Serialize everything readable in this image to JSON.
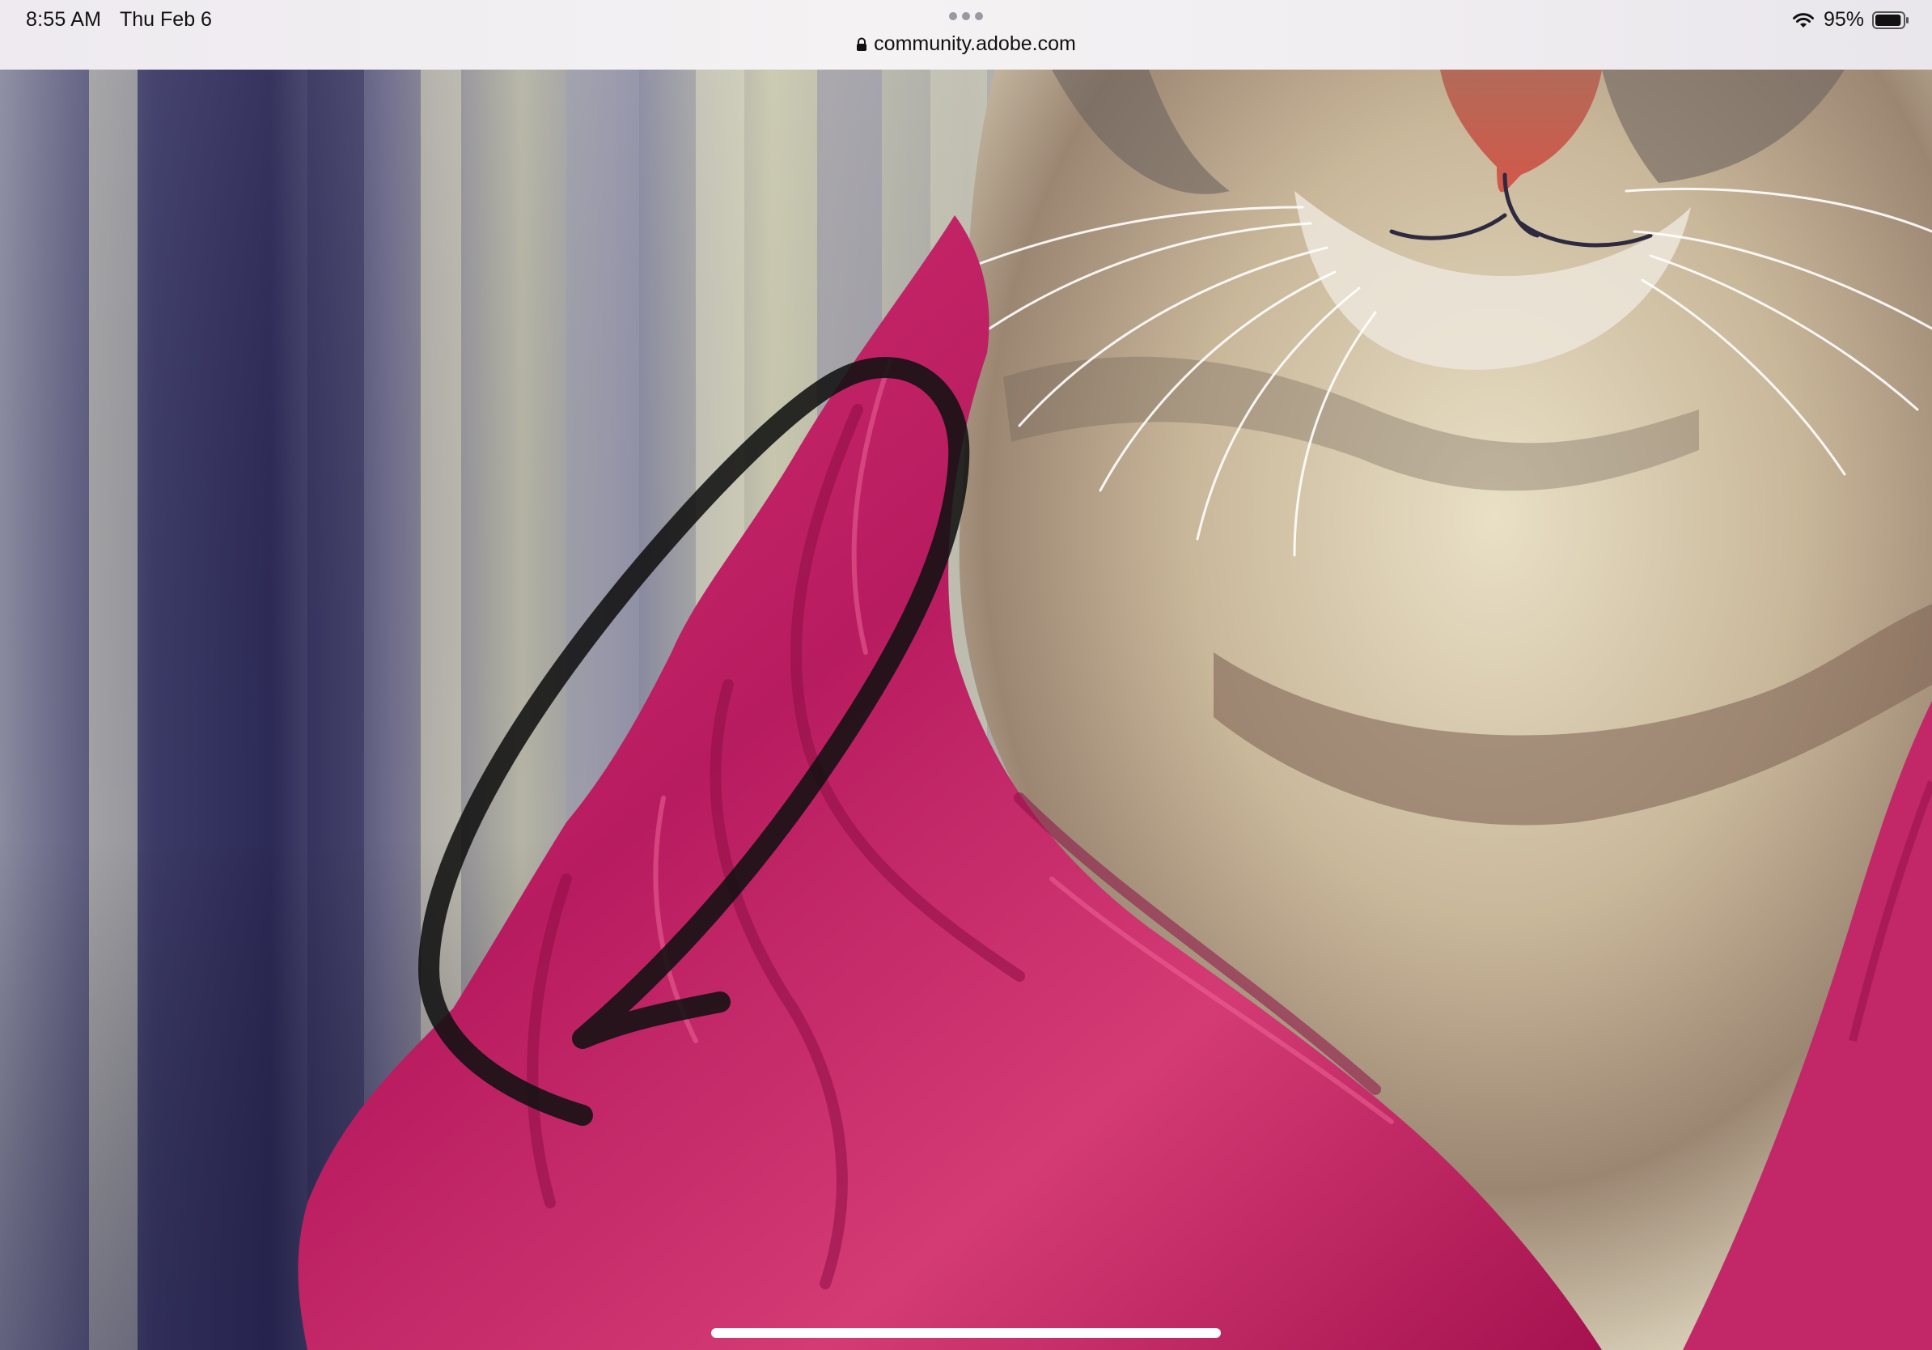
{
  "status_bar": {
    "time": "8:55 AM",
    "date": "Thu Feb 6",
    "battery_percent": "95%",
    "battery_level": 0.95,
    "wifi_icon": "wifi-icon",
    "battery_icon": "battery-icon"
  },
  "browser": {
    "url": "community.adobe.com",
    "secure_icon": "lock-icon",
    "more_icon": "more-dots-icon"
  },
  "content": {
    "image_subject": "stylized cat wearing a magenta robe",
    "annotation": "hand-drawn black ellipse",
    "colors": {
      "robe": "#c8236a",
      "robe_dark": "#8e0f45",
      "fur_light": "#e6dbc0",
      "fur_dark": "#6e5a4e",
      "background_light": "#c7c6b0",
      "background_dark": "#2f2c52",
      "annotation_stroke": "#111111"
    }
  }
}
